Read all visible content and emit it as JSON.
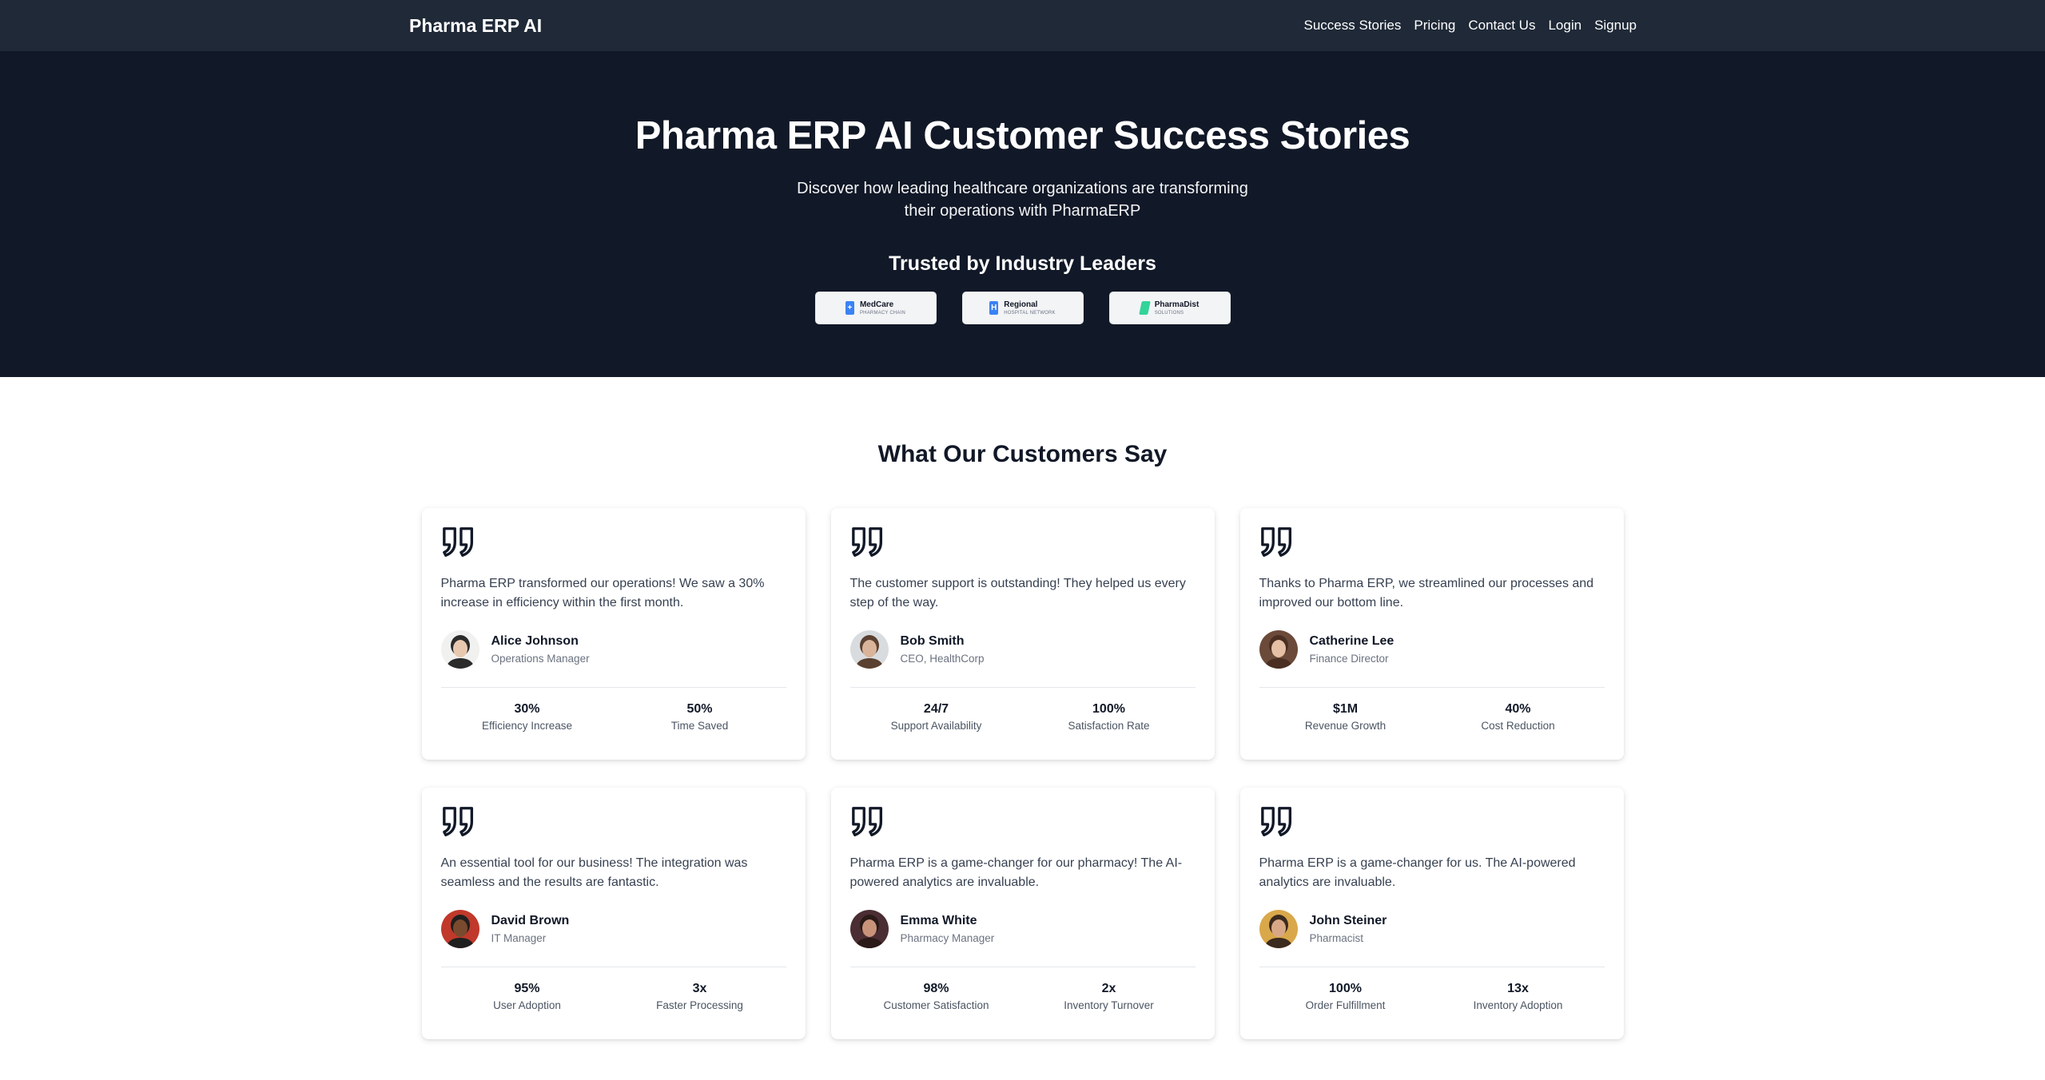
{
  "nav": {
    "brand": "Pharma ERP AI",
    "links": [
      "Success Stories",
      "Pricing",
      "Contact Us",
      "Login",
      "Signup"
    ]
  },
  "hero": {
    "title": "Pharma ERP AI Customer Success Stories",
    "subtitle": "Discover how leading healthcare organizations are transforming their operations with PharmaERP",
    "trusted_title": "Trusted by Industry Leaders",
    "logos": [
      {
        "name": "MedCare",
        "tag": "PHARMACY CHAIN",
        "color": "#3b82f6",
        "icon": "medical-cross-icon"
      },
      {
        "name": "Regional",
        "tag": "HOSPITAL NETWORK",
        "color": "#3b82f6",
        "icon": "hospital-icon"
      },
      {
        "name": "PharmaDist",
        "tag": "SOLUTIONS",
        "color": "#34d399",
        "icon": "leaf-icon"
      }
    ]
  },
  "testimonials": {
    "title": "What Our Customers Say",
    "items": [
      {
        "quote": "Pharma ERP transformed our operations! We saw a 30% increase in efficiency within the first month.",
        "name": "Alice Johnson",
        "role": "Operations Manager",
        "stats": [
          {
            "value": "30%",
            "label": "Efficiency Increase"
          },
          {
            "value": "50%",
            "label": "Time Saved"
          }
        ],
        "avatar": {
          "bg": "#f1f1ef",
          "skin": "#e8c9b0",
          "hair": "#2b2b2b"
        }
      },
      {
        "quote": "The customer support is outstanding! They helped us every step of the way.",
        "name": "Bob Smith",
        "role": "CEO, HealthCorp",
        "stats": [
          {
            "value": "24/7",
            "label": "Support Availability"
          },
          {
            "value": "100%",
            "label": "Satisfaction Rate"
          }
        ],
        "avatar": {
          "bg": "#d9dcdf",
          "skin": "#d9b49a",
          "hair": "#5a4030"
        }
      },
      {
        "quote": "Thanks to Pharma ERP, we streamlined our processes and improved our bottom line.",
        "name": "Catherine Lee",
        "role": "Finance Director",
        "stats": [
          {
            "value": "$1M",
            "label": "Revenue Growth"
          },
          {
            "value": "40%",
            "label": "Cost Reduction"
          }
        ],
        "avatar": {
          "bg": "#6b4a3a",
          "skin": "#e6c0a4",
          "hair": "#4a2f22"
        }
      },
      {
        "quote": "An essential tool for our business! The integration was seamless and the results are fantastic.",
        "name": "David Brown",
        "role": "IT Manager",
        "stats": [
          {
            "value": "95%",
            "label": "User Adoption"
          },
          {
            "value": "3x",
            "label": "Faster Processing"
          }
        ],
        "avatar": {
          "bg": "#c0392b",
          "skin": "#7a4a2e",
          "hair": "#1f1f1f"
        }
      },
      {
        "quote": "Pharma ERP is a game-changer for our pharmacy! The AI-powered analytics are invaluable.",
        "name": "Emma White",
        "role": "Pharmacy Manager",
        "stats": [
          {
            "value": "98%",
            "label": "Customer Satisfaction"
          },
          {
            "value": "2x",
            "label": "Inventory Turnover"
          }
        ],
        "avatar": {
          "bg": "#4a2e33",
          "skin": "#c9937a",
          "hair": "#2a1a18"
        }
      },
      {
        "quote": "Pharma ERP is a game-changer for us. The AI-powered analytics are invaluable.",
        "name": "John Steiner",
        "role": "Pharmacist",
        "stats": [
          {
            "value": "100%",
            "label": "Order Fulfillment"
          },
          {
            "value": "13x",
            "label": "Inventory Adoption"
          }
        ],
        "avatar": {
          "bg": "#d9a84a",
          "skin": "#d8a886",
          "hair": "#3b2a1e"
        }
      }
    ]
  }
}
